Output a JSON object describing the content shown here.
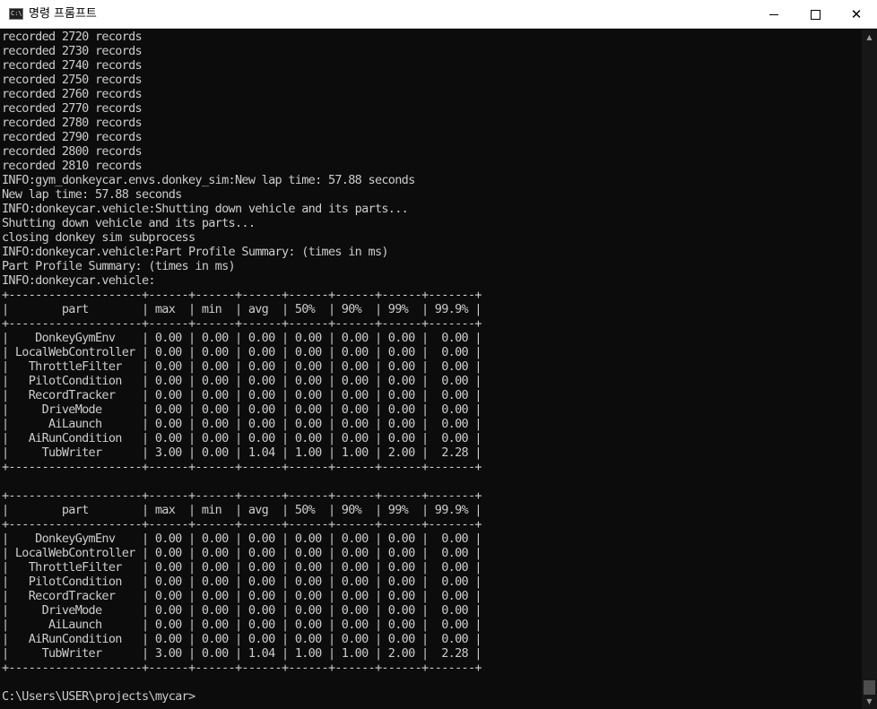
{
  "window": {
    "title": "명령 프롬프트",
    "icon_text": "C:\\"
  },
  "console_lines": [
    "recorded 2720 records",
    "recorded 2730 records",
    "recorded 2740 records",
    "recorded 2750 records",
    "recorded 2760 records",
    "recorded 2770 records",
    "recorded 2780 records",
    "recorded 2790 records",
    "recorded 2800 records",
    "recorded 2810 records",
    "INFO:gym_donkeycar.envs.donkey_sim:New lap time: 57.88 seconds",
    "New lap time: 57.88 seconds",
    "INFO:donkeycar.vehicle:Shutting down vehicle and its parts...",
    "Shutting down vehicle and its parts...",
    "closing donkey sim subprocess",
    "INFO:donkeycar.vehicle:Part Profile Summary: (times in ms)",
    "Part Profile Summary: (times in ms)",
    "INFO:donkeycar.vehicle:",
    "+--------------------+------+------+------+------+------+------+-------+",
    "|        part        | max  | min  | avg  | 50%  | 90%  | 99%  | 99.9% |",
    "+--------------------+------+------+------+------+------+------+-------+",
    "|    DonkeyGymEnv    | 0.00 | 0.00 | 0.00 | 0.00 | 0.00 | 0.00 |  0.00 |",
    "| LocalWebController | 0.00 | 0.00 | 0.00 | 0.00 | 0.00 | 0.00 |  0.00 |",
    "|   ThrottleFilter   | 0.00 | 0.00 | 0.00 | 0.00 | 0.00 | 0.00 |  0.00 |",
    "|   PilotCondition   | 0.00 | 0.00 | 0.00 | 0.00 | 0.00 | 0.00 |  0.00 |",
    "|   RecordTracker    | 0.00 | 0.00 | 0.00 | 0.00 | 0.00 | 0.00 |  0.00 |",
    "|     DriveMode      | 0.00 | 0.00 | 0.00 | 0.00 | 0.00 | 0.00 |  0.00 |",
    "|      AiLaunch      | 0.00 | 0.00 | 0.00 | 0.00 | 0.00 | 0.00 |  0.00 |",
    "|   AiRunCondition   | 0.00 | 0.00 | 0.00 | 0.00 | 0.00 | 0.00 |  0.00 |",
    "|     TubWriter      | 3.00 | 0.00 | 1.04 | 1.00 | 1.00 | 2.00 |  2.28 |",
    "+--------------------+------+------+------+------+------+------+-------+",
    "",
    "+--------------------+------+------+------+------+------+------+-------+",
    "|        part        | max  | min  | avg  | 50%  | 90%  | 99%  | 99.9% |",
    "+--------------------+------+------+------+------+------+------+-------+",
    "|    DonkeyGymEnv    | 0.00 | 0.00 | 0.00 | 0.00 | 0.00 | 0.00 |  0.00 |",
    "| LocalWebController | 0.00 | 0.00 | 0.00 | 0.00 | 0.00 | 0.00 |  0.00 |",
    "|   ThrottleFilter   | 0.00 | 0.00 | 0.00 | 0.00 | 0.00 | 0.00 |  0.00 |",
    "|   PilotCondition   | 0.00 | 0.00 | 0.00 | 0.00 | 0.00 | 0.00 |  0.00 |",
    "|   RecordTracker    | 0.00 | 0.00 | 0.00 | 0.00 | 0.00 | 0.00 |  0.00 |",
    "|     DriveMode      | 0.00 | 0.00 | 0.00 | 0.00 | 0.00 | 0.00 |  0.00 |",
    "|      AiLaunch      | 0.00 | 0.00 | 0.00 | 0.00 | 0.00 | 0.00 |  0.00 |",
    "|   AiRunCondition   | 0.00 | 0.00 | 0.00 | 0.00 | 0.00 | 0.00 |  0.00 |",
    "|     TubWriter      | 3.00 | 0.00 | 1.04 | 1.00 | 1.00 | 2.00 |  2.28 |",
    "+--------------------+------+------+------+------+------+------+-------+",
    "",
    "C:\\Users\\USER\\projects\\mycar>"
  ],
  "colors": {
    "background": "#0c0c0c",
    "text": "#cccccc",
    "titlebar": "#ffffff"
  }
}
